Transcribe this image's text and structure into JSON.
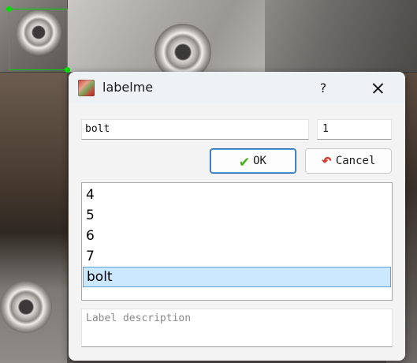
{
  "dialog": {
    "title": "labelme",
    "help_label": "?",
    "label_value": "bolt",
    "group_id_value": "1",
    "ok_label": "OK",
    "cancel_label": "Cancel",
    "label_list": [
      {
        "label": "4",
        "selected": false
      },
      {
        "label": "5",
        "selected": false
      },
      {
        "label": "6",
        "selected": false
      },
      {
        "label": "7",
        "selected": false
      },
      {
        "label": "bolt",
        "selected": true
      }
    ],
    "description_placeholder": "Label description"
  },
  "icons": {
    "app": "labelme-app-icon",
    "ok": "check-icon",
    "cancel": "undo-arrow-icon",
    "close": "close-icon"
  },
  "colors": {
    "bbox": "#00d400",
    "selection_bg": "#cce8ff",
    "ok_border": "#1f5fa8"
  }
}
